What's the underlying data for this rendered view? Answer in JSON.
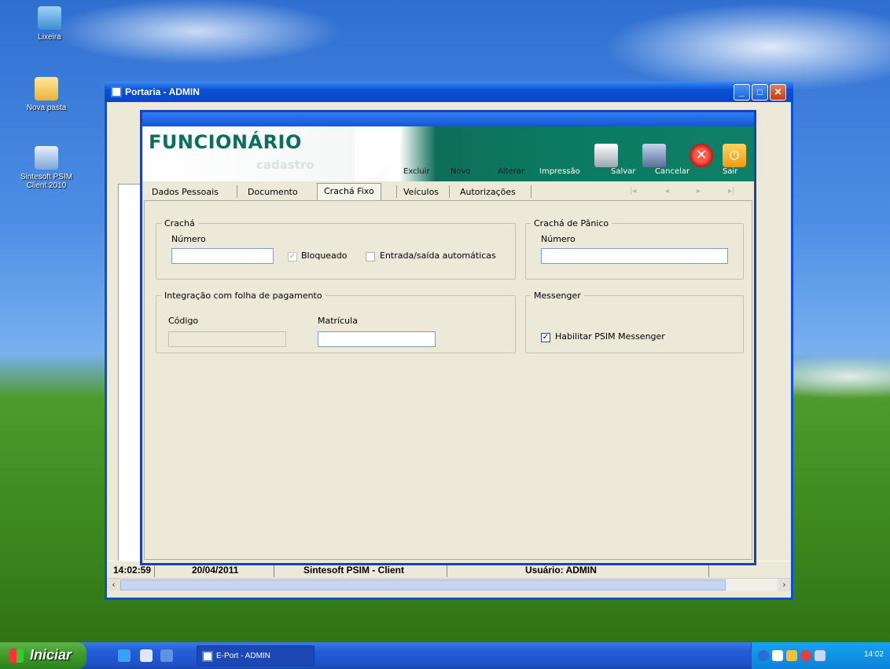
{
  "desktop": {
    "icons": [
      {
        "label": "Lixeira"
      },
      {
        "label": "Nova pasta"
      },
      {
        "label": "Sintesoft PSIM Client 2010"
      }
    ]
  },
  "window": {
    "title": "Portaria - ADMIN",
    "status": {
      "time": "14:02:59",
      "date": "20/04/2011",
      "app": "Sintesoft PSIM - Client",
      "user": "Usuário: ADMIN"
    }
  },
  "dialog": {
    "title": "FUNCIONÁRIO",
    "subtitle": "cadastro",
    "toolbar": {
      "excluir": "Excluir",
      "novo": "Novo",
      "alterar": "Alterar",
      "impressao": "Impressão",
      "salvar": "Salvar",
      "cancelar": "Cancelar",
      "sair": "Sair"
    },
    "tabs": [
      "Dados Pessoais",
      "Documento",
      "Crachá Fixo",
      "Veículos",
      "Autorizações"
    ],
    "active_tab": "Crachá Fixo",
    "cracha": {
      "legend": "Crachá",
      "numero_label": "Número",
      "numero_value": "",
      "bloqueado_label": "Bloqueado",
      "bloqueado_checked": true,
      "entrada_label": "Entrada/saída automáticas",
      "entrada_checked": false
    },
    "cracha_panico": {
      "legend": "Crachá de Pânico",
      "numero_label": "Número",
      "numero_value": ""
    },
    "integracao": {
      "legend": "Integração com folha de pagamento",
      "codigo_label": "Código",
      "codigo_value": "",
      "matricula_label": "Matrícula",
      "matricula_value": ""
    },
    "messenger": {
      "legend": "Messenger",
      "habilitar_label": "Habilitar PSIM Messenger",
      "habilitar_checked": true
    }
  },
  "taskbar": {
    "start_label": "Iniciar",
    "task_label": "E-Port - ADMIN",
    "clock": "14:02"
  }
}
